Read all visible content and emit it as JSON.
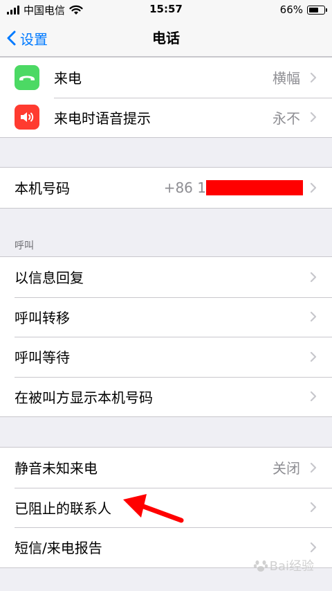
{
  "status_bar": {
    "carrier": "中国电信",
    "time": "15:57",
    "battery_percent": "66%",
    "battery_level": 0.66,
    "icons": [
      "signal-icon",
      "wifi-icon",
      "battery-icon"
    ]
  },
  "nav": {
    "back_label": "设置",
    "title": "电话"
  },
  "group1": {
    "items": [
      {
        "label": "来电",
        "value": "横幅",
        "icon": "phone-icon",
        "icon_color": "#4cd964"
      },
      {
        "label": "来电时语音提示",
        "value": "永不",
        "icon": "speaker-icon",
        "icon_color": "#ff3b30"
      }
    ]
  },
  "group2": {
    "items": [
      {
        "label": "本机号码",
        "value": "+86 1"
      }
    ]
  },
  "section_calls": {
    "header": "呼叫",
    "items": [
      {
        "label": "以信息回复"
      },
      {
        "label": "呼叫转移"
      },
      {
        "label": "呼叫等待"
      },
      {
        "label": "在被叫方显示本机号码"
      }
    ]
  },
  "group4": {
    "items": [
      {
        "label": "静音未知来电",
        "value": "关闭"
      },
      {
        "label": "已阻止的联系人"
      },
      {
        "label": "短信/来电报告"
      }
    ]
  },
  "annotation": {
    "color": "#ff0000"
  },
  "watermark": {
    "text": "Bai经验"
  },
  "colors": {
    "accent": "#007aff",
    "background": "#efeff4",
    "secondary_text": "#8e8e93",
    "separator": "#c8c7cc"
  }
}
